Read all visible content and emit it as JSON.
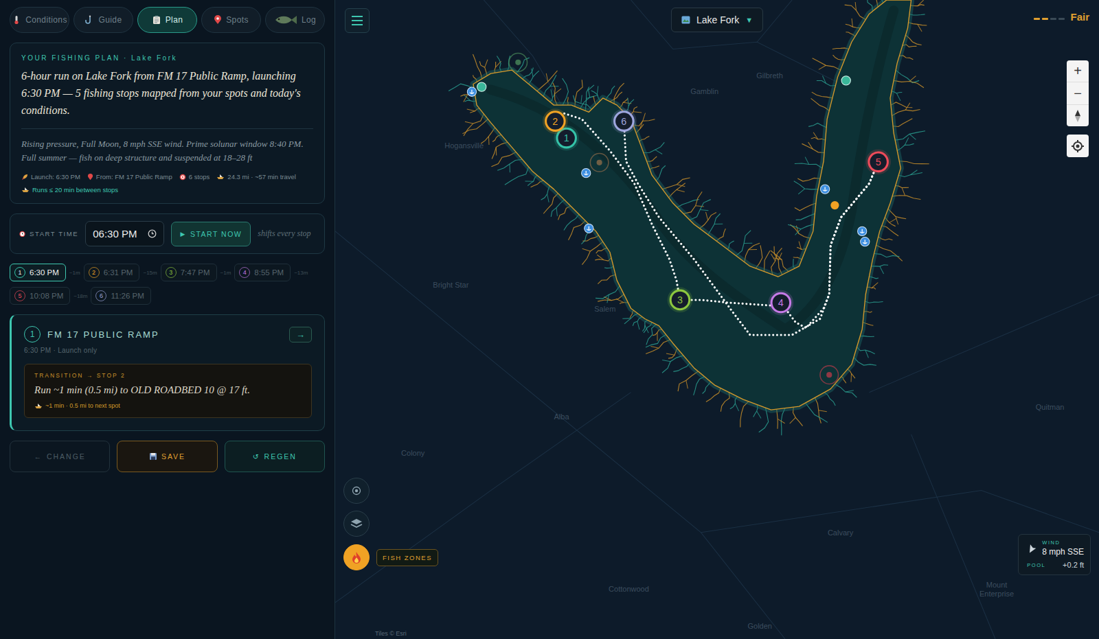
{
  "tabs": [
    {
      "label": "Conditions",
      "selected": false
    },
    {
      "label": "Guide",
      "selected": false
    },
    {
      "label": "Plan",
      "selected": true
    },
    {
      "label": "Spots",
      "selected": false
    },
    {
      "label": "Log",
      "selected": false
    }
  ],
  "plan": {
    "heading": "YOUR FISHING PLAN · Lake Fork",
    "summary": "6-hour run on Lake Fork from FM 17 Public Ramp, launching 6:30 PM — 5 fishing stops mapped from your spots and today's conditions.",
    "conditions": "Rising pressure, Full Moon, 8 mph SSE wind. Prime solunar window 8:40 PM. Full summer — fish on deep structure and suspended at 18–28 ft",
    "meta": [
      "Launch: 6:30 PM",
      "From: FM 17 Public Ramp",
      "6 stops",
      "24.3 mi · ~57 min travel"
    ],
    "runs_note": "Runs ≤ 20 min between stops"
  },
  "start": {
    "label": "START TIME",
    "value": "06:30 PM",
    "button_icon": "▶",
    "button": "START NOW",
    "hint": "shifts every stop"
  },
  "timeline": [
    {
      "number": "1",
      "time": "6:30 PM",
      "gap": "~1m",
      "selected": true,
      "color": "#35c2a8"
    },
    {
      "number": "2",
      "time": "6:31 PM",
      "gap": "~15m",
      "selected": false,
      "color": "#f0a224"
    },
    {
      "number": "3",
      "time": "7:47 PM",
      "gap": "~1m",
      "selected": false,
      "color": "#8cc63f"
    },
    {
      "number": "4",
      "time": "8:55 PM",
      "gap": "~13m",
      "selected": false,
      "color": "#c57ae6"
    },
    {
      "number": "5",
      "time": "10:08 PM",
      "gap": "~18m",
      "selected": false,
      "color": "#ee4b5a"
    },
    {
      "number": "6",
      "time": "11:26 PM",
      "selected": false,
      "color": "#9ea6de"
    }
  ],
  "stop_card": {
    "number": "1",
    "title": "FM 17 PUBLIC RAMP",
    "go": "→",
    "subtitle": "6:30 PM · Launch only",
    "transition_label": "TRANSITION → STOP 2",
    "transition_text": "Run ~1 min (0.5 mi) to OLD ROADBED 10 @ 17 ft.",
    "transition_note": "~1 min · 0.5 mi to next spot"
  },
  "actions": [
    {
      "icon": "←",
      "label": "CHANGE",
      "kind": "plain"
    },
    {
      "label": "SAVE",
      "kind": "save"
    },
    {
      "icon": "↺",
      "label": "REGEN",
      "kind": "regen"
    }
  ],
  "map": {
    "lake_selector": {
      "label": "Lake Fork",
      "caret": "▼"
    },
    "rating": {
      "label": "Fair",
      "level": 0.5
    },
    "zoom_in": "+",
    "zoom_out": "−",
    "fish_zones": "FISH ZONES",
    "wind": {
      "label": "WIND",
      "value": "8 mph SSE",
      "pool_label": "POOL",
      "pool_value": "+0.2 ft"
    },
    "towns": [
      "Gilbreth",
      "Gamblin",
      "Hogansville",
      "Bright Star",
      "Salem",
      "Alba",
      "Colony",
      "Cottonwood",
      "Golden",
      "Calvary",
      "Quitman",
      "Mount Enterprise"
    ],
    "attribution": "Tiles © Esri"
  }
}
